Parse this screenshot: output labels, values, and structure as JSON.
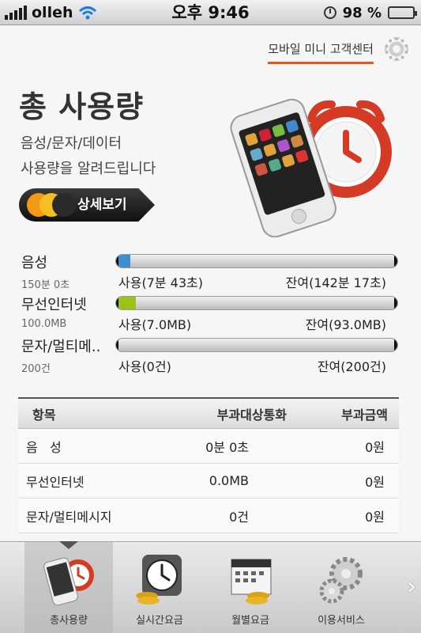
{
  "status_bar": {
    "carrier": "olleh",
    "time": "오후 9:46",
    "battery": "98 %"
  },
  "header": {
    "support_link": "모바일 미니 고객센터"
  },
  "hero": {
    "title": "총 사용량",
    "subtitle_line1": "음성/문자/데이터",
    "subtitle_line2": "사용량을 알려드립니다",
    "detail_button": "상세보기"
  },
  "usage": [
    {
      "name": "음성",
      "quantity": "150분 0초",
      "used": "사용(7분 43초)",
      "remaining": "잔여(142분 17초)",
      "used_fraction": 0.05,
      "color": "#3d8fd0"
    },
    {
      "name": "무선인터넷",
      "quantity": "100.0MB",
      "used": "사용(7.0MB)",
      "remaining": "잔여(93.0MB)",
      "used_fraction": 0.07,
      "color": "#9cc21a"
    },
    {
      "name": "문자/멀티메..",
      "quantity": "200건",
      "used": "사용(0건)",
      "remaining": "잔여(200건)",
      "used_fraction": 0.0,
      "color": "#888888"
    }
  ],
  "table": {
    "headers": [
      "항목",
      "부과대상통화",
      "부과금액"
    ],
    "rows": [
      [
        "음   성",
        "0분 0초",
        "0원"
      ],
      [
        "무선인터넷",
        "0.0MB",
        "0원"
      ],
      [
        "문자/멀티메시지",
        "0건",
        "0원"
      ]
    ]
  },
  "tabs": [
    {
      "label": "총사용량",
      "icon": "phone-alarm-icon",
      "active": true
    },
    {
      "label": "실시간요금",
      "icon": "clock-coins-icon",
      "active": false
    },
    {
      "label": "월별요금",
      "icon": "calendar-coins-icon",
      "active": false
    },
    {
      "label": "이용서비스",
      "icon": "gears-icon",
      "active": false
    }
  ],
  "colors": {
    "accent": "#e05a1c",
    "detail_orange": "#f29a16"
  }
}
